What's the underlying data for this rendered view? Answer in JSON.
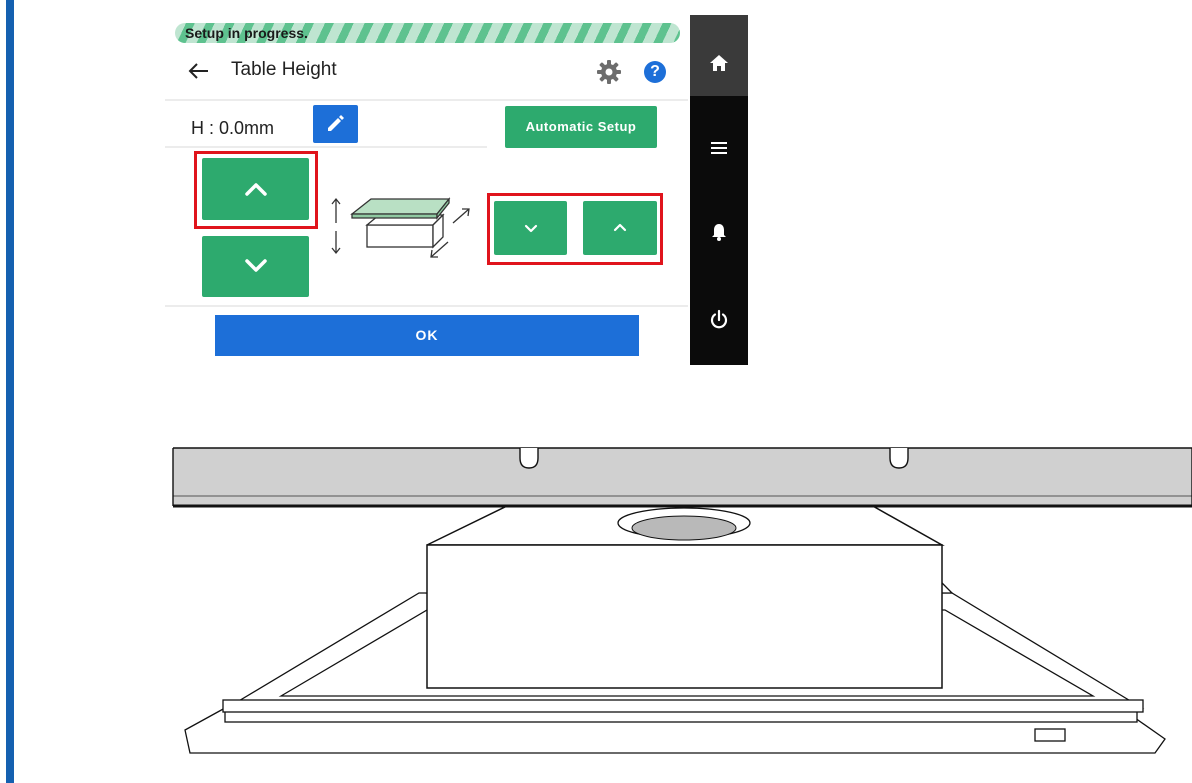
{
  "progress": {
    "text": "Setup in progress."
  },
  "header": {
    "title": "Table Height"
  },
  "height": {
    "label": "H : 0.0mm"
  },
  "buttons": {
    "automatic_setup": "Automatic Setup",
    "ok": "OK"
  },
  "icons": {
    "back": "arrow-left-icon",
    "settings": "gear-icon",
    "help": "help-icon",
    "help_glyph": "?",
    "edit": "pencil-icon",
    "home": "home-icon",
    "menu": "menu-icon",
    "notifications": "bell-icon",
    "power": "power-icon"
  },
  "colors": {
    "accent_green": "#2daa6e",
    "accent_blue": "#1d6fd8",
    "highlight_red": "#e0141c",
    "nav_bg": "#0b0b0b",
    "doc_bar": "#1560b0"
  }
}
